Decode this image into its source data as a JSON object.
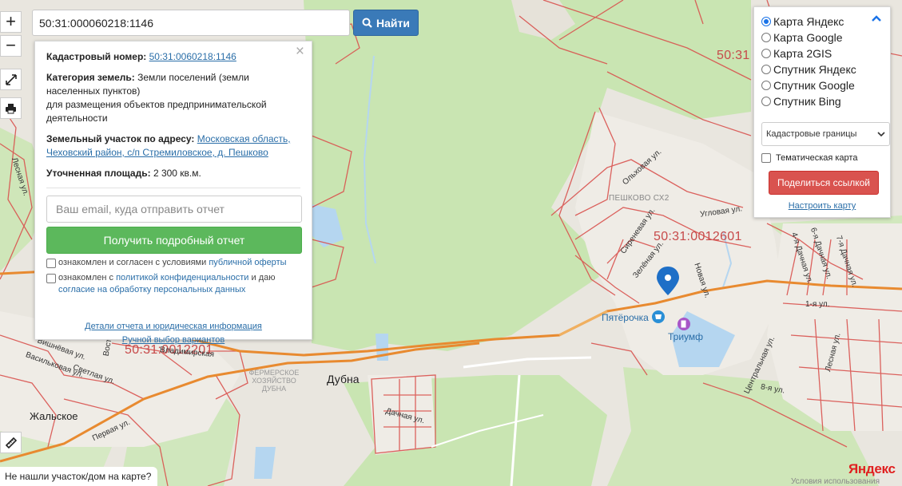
{
  "search": {
    "value": "50:31:000060218:1146",
    "button_label": "Найти"
  },
  "zoom": {
    "plus": "+",
    "minus": "−"
  },
  "info": {
    "cad_label": "Кадастровый номер:",
    "cad_value": "50:31:0060218:1146",
    "cat_label": "Категория земель:",
    "cat_value": "Земли поселений (земли населенных пунктов)",
    "cat_use": "для размещения объектов предпринимательской деятельности",
    "addr_label": "Земельный участок по адресу:",
    "addr_value": "Московская область, Чеховский район, с/п Стремиловское, д. Пешково",
    "area_label": "Уточненная площадь:",
    "area_value": "2 300 кв.м.",
    "email_placeholder": "Ваш email, куда отправить отчет",
    "report_button": "Получить подробный отчет",
    "consent1_text": "ознакомлен и согласен с условиями",
    "consent1_link": "публичной оферты",
    "consent2_text": "ознакомлен с",
    "consent2_link": "политикой конфиденциальности",
    "consent2_tail": "и даю",
    "consent2_link2": "согласие на обработку персональных данных",
    "details_link": "Детали отчета и юридическая информация",
    "manual_link": "Ручной выбор вариантов"
  },
  "layers": {
    "options": [
      {
        "label": "Карта Яндекс",
        "selected": true
      },
      {
        "label": "Карта Google",
        "selected": false
      },
      {
        "label": "Карта 2GIS",
        "selected": false
      },
      {
        "label": "Спутник Яндекс",
        "selected": false
      },
      {
        "label": "Спутник Google",
        "selected": false
      },
      {
        "label": "Спутник Bing",
        "selected": false
      }
    ],
    "select_value": "Кадастровые границы",
    "thematic_label": "Тематическая карта",
    "share_button": "Поделиться ссылкой",
    "configure_link": "Настроить карту"
  },
  "map": {
    "cad_quarters": [
      "50:31:0012601",
      "50:31:0012201",
      "50:31"
    ],
    "places": {
      "dubna": "Дубна",
      "zhalskoe": "Жальское",
      "peshkovo": "ПЕШКОВО СХ2",
      "farm": "ФЕРМЕРСКОЕ ХОЗЯЙСТВО ДУБНА"
    },
    "pois": {
      "pyaterochka": "Пятёрочка",
      "triumf": "Триумф"
    },
    "streets": {
      "olkovaya": "Ольховая ул.",
      "sirenevaya": "Сиреневая ул.",
      "zelenaya": "Зелёная ул.",
      "uglovaya": "Угловая ул.",
      "novaya": "Новая ул.",
      "dachnaya4": "4-я Дачная ул.",
      "dachnaya6": "6-я Дачная ул.",
      "dachnaya7": "7-я Дачная ул.",
      "first": "1-я ул.",
      "centralnaya": "Центральная ул.",
      "lesnaya": "Лесная ул.",
      "eighth": "8-я ул.",
      "dachnaya": "Дачная ул.",
      "pervaya": "Первая ул.",
      "vishnevaya": "Вишнёвая ул.",
      "vasilkovaya": "Васильковая ул.",
      "svetlaya": "Светлая ул.",
      "vladimirskaya": "Владимирская",
      "lesnaya_left": "Лесная ул.",
      "vost": "Вост"
    }
  },
  "footer": {
    "not_found": "Не нашли участок/дом на карте?",
    "brand": "Яндекс",
    "terms": "Условия использования"
  },
  "colors": {
    "accent_blue": "#3a7ab8",
    "report_green": "#5cb85c",
    "share_red": "#d9534f",
    "cad_border": "#d9534f",
    "road": "#f0a040",
    "forest": "#c9e5b2",
    "water": "#b5d6f0"
  }
}
